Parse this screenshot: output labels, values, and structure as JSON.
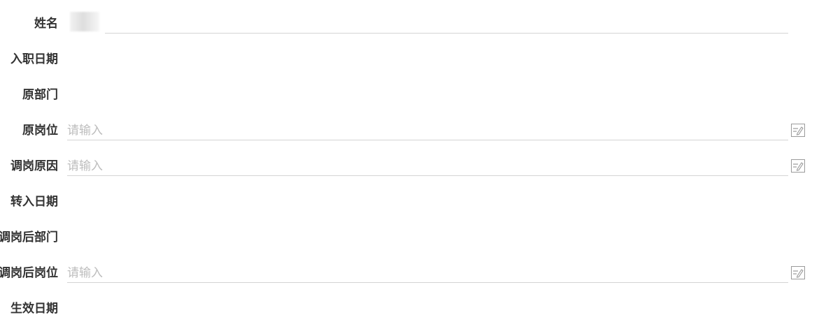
{
  "form": {
    "fields": [
      {
        "label": "姓名"
      },
      {
        "label": "入职日期"
      },
      {
        "label": "原部门"
      },
      {
        "label": "原岗位",
        "placeholder": "请输入"
      },
      {
        "label": "调岗原因",
        "placeholder": "请输入"
      },
      {
        "label": "转入日期"
      },
      {
        "label": "调岗后部门"
      },
      {
        "label": "调岗后岗位",
        "placeholder": "请输入"
      },
      {
        "label": "生效日期"
      }
    ]
  },
  "icons": {
    "edit": "edit-icon"
  },
  "colors": {
    "label": "#333333",
    "placeholder": "#bdbdbd",
    "underline": "#d4d4d4",
    "icon": "#9a9a9a"
  }
}
